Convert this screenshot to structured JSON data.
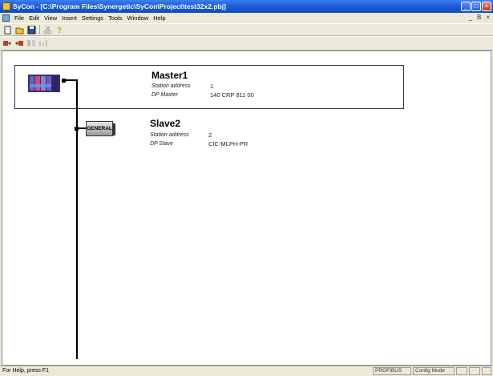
{
  "window": {
    "title": "SyCon - [C:\\Program Files\\Synergetic\\SyCon\\Project\\test32x2.pbj]",
    "controls": [
      "minimize-icon",
      "maximize-icon",
      "close-icon"
    ]
  },
  "menubar": {
    "items": [
      "File",
      "Edit",
      "View",
      "Insert",
      "Settings",
      "Tools",
      "Window",
      "Help"
    ],
    "mdi_controls": [
      "_",
      "Β",
      "×"
    ]
  },
  "toolbar1": {
    "icons": [
      "new-icon",
      "open-icon",
      "save-icon",
      "cut-icon",
      "help-icon"
    ]
  },
  "toolbar2": {
    "icons": [
      "insert-master-icon",
      "insert-slave-icon",
      "device-assignment-icon",
      "network-scan-icon"
    ]
  },
  "devices": {
    "master": {
      "name": "Master1",
      "station_label": "Station address",
      "station_value": "1",
      "type_label": "DP Master",
      "type_value": "140 CRP 811 00"
    },
    "slave": {
      "name": "Slave2",
      "station_label": "Station address",
      "station_value": "2",
      "type_label": "DP Slave",
      "type_value": "CIC-MLPH-PR",
      "image_label": "GENERAL"
    }
  },
  "statusbar": {
    "help_text": "For Help, press F1",
    "bus": "PROFIBUS",
    "mode": "Config Mode"
  }
}
